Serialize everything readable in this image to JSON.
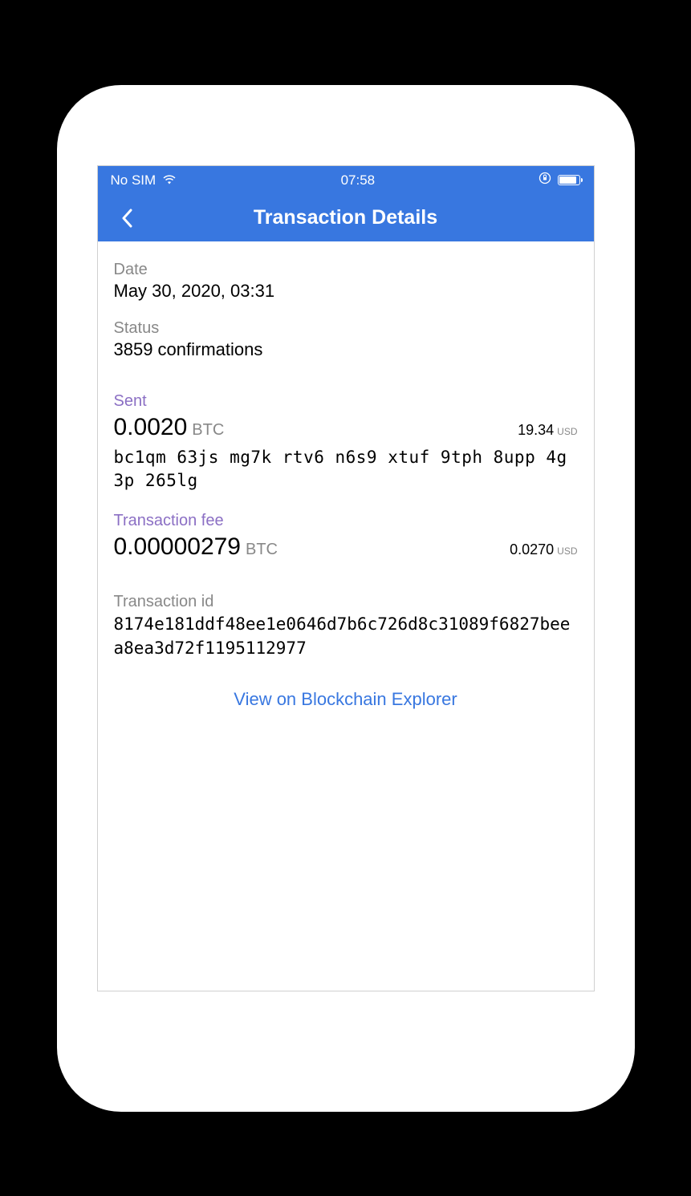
{
  "status_bar": {
    "carrier": "No SIM",
    "time": "07:58"
  },
  "nav": {
    "title": "Transaction Details"
  },
  "date": {
    "label": "Date",
    "value": "May 30, 2020, 03:31"
  },
  "status": {
    "label": "Status",
    "value": "3859 confirmations"
  },
  "sent": {
    "label": "Sent",
    "amount": "0.0020",
    "unit": "BTC",
    "fiat": "19.34",
    "fiat_unit": "USD",
    "address": "bc1qm 63js mg7k rtv6 n6s9 xtuf 9tph 8upp 4g3p 265lg"
  },
  "fee": {
    "label": "Transaction fee",
    "amount": "0.00000279",
    "unit": "BTC",
    "fiat": "0.0270",
    "fiat_unit": "USD"
  },
  "txid": {
    "label": "Transaction id",
    "value": "8174e181ddf48ee1e0646d7b6c726d8c31089f6827beea8ea3d72f1195112977"
  },
  "explorer": {
    "link_text": "View on Blockchain Explorer"
  }
}
